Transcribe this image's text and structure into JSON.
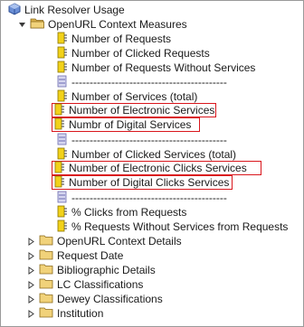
{
  "root": {
    "label": "Link Resolver Usage"
  },
  "openurl_measures": {
    "label": "OpenURL Context Measures",
    "items": [
      {
        "label": "Number of Requests"
      },
      {
        "label": "Number of Clicked Requests"
      },
      {
        "label": "Number of Requests Without Services"
      },
      {
        "label": "-------------------------------------------"
      },
      {
        "label": "Number of Services (total)"
      },
      {
        "label": "Number of Electronic Services"
      },
      {
        "label": "Numbr of Digital Services"
      },
      {
        "label": "-------------------------------------------"
      },
      {
        "label": "Number of Clicked Services (total)"
      },
      {
        "label": "Number of Electronic Clicks Services"
      },
      {
        "label": "Number of Digital Clicks Services"
      },
      {
        "label": "-------------------------------------------"
      },
      {
        "label": "% Clicks from Requests"
      },
      {
        "label": "% Requests Without Services from Requests"
      }
    ]
  },
  "folders": [
    {
      "label": "OpenURL Context Details"
    },
    {
      "label": "Request Date"
    },
    {
      "label": "Bibliographic Details"
    },
    {
      "label": "LC Classifications"
    },
    {
      "label": "Dewey Classifications"
    },
    {
      "label": "Institution"
    }
  ],
  "colors": {
    "highlight": "#d9161c",
    "folder": "#e9c455",
    "measure": "#f2d21a",
    "separator": "#8a8ac8"
  },
  "icons": {
    "expanded": "triangle-down-icon",
    "collapsed": "triangle-right-icon"
  }
}
